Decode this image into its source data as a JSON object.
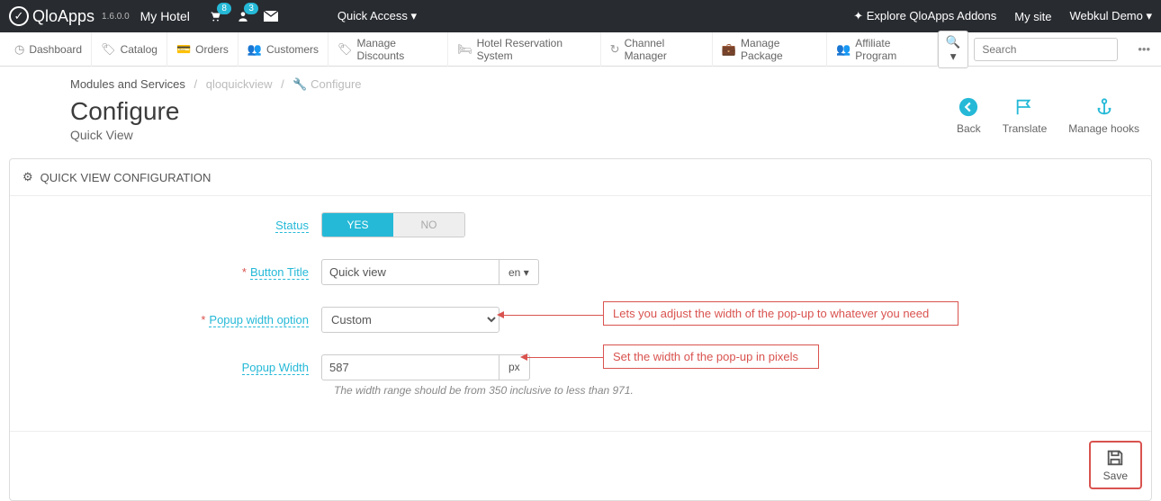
{
  "top": {
    "brand": "QloApps",
    "version": "1.6.0.0",
    "hotel": "My Hotel",
    "cart_badge": "8",
    "user_badge": "3",
    "quick_access": "Quick Access",
    "addons": "Explore QloApps Addons",
    "my_site": "My site",
    "username": "Webkul Demo"
  },
  "nav": {
    "items": [
      "Dashboard",
      "Catalog",
      "Orders",
      "Customers",
      "Manage Discounts",
      "Hotel Reservation System",
      "Channel Manager",
      "Manage Package",
      "Affiliate Program"
    ],
    "search_placeholder": "Search"
  },
  "breadcrumb": {
    "root": "Modules and Services",
    "module": "qloquickview",
    "page": "Configure"
  },
  "header": {
    "title": "Configure",
    "subtitle": "Quick View",
    "actions": {
      "back": "Back",
      "translate": "Translate",
      "hooks": "Manage hooks"
    }
  },
  "panel": {
    "heading": "QUICK VIEW CONFIGURATION",
    "status_label": "Status",
    "yes": "YES",
    "no": "NO",
    "button_title_label": "Button Title",
    "button_title_value": "Quick view",
    "lang": "en",
    "popup_option_label": "Popup width option",
    "popup_option_value": "Custom",
    "popup_width_label": "Popup Width",
    "popup_width_value": "587",
    "px": "px",
    "help": "The width range should be from 350 inclusive to less than 971.",
    "save": "Save"
  },
  "annotations": {
    "a1": "Lets you adjust the width of the pop-up to whatever you need",
    "a2": "Set the width of the pop-up in pixels"
  }
}
